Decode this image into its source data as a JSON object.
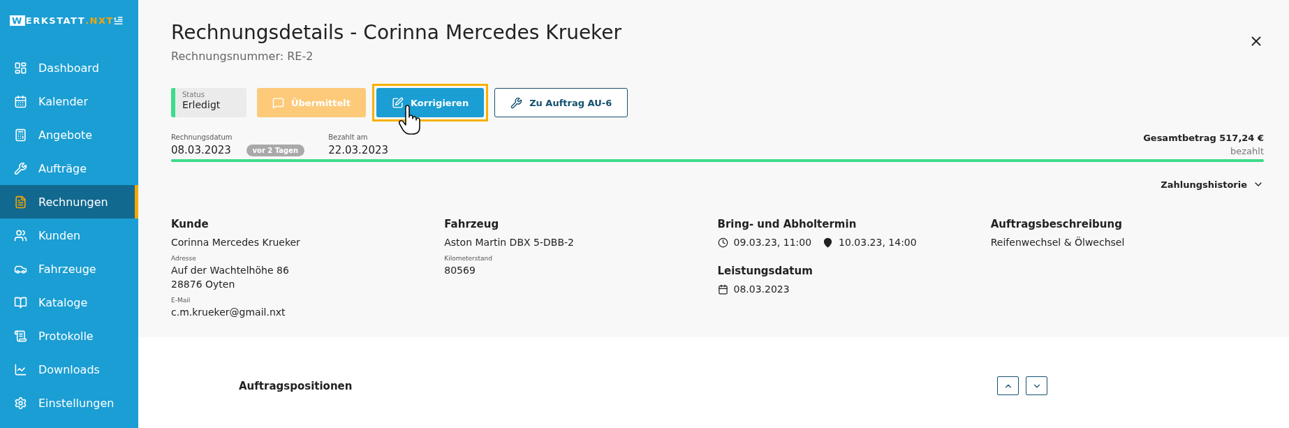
{
  "sidebar": {
    "logo": {
      "initial": "W",
      "name": "ERKSTATT",
      "suffix": ".NXT"
    },
    "items": [
      {
        "label": "Dashboard",
        "selected": false
      },
      {
        "label": "Kalender",
        "selected": false
      },
      {
        "label": "Angebote",
        "selected": false
      },
      {
        "label": "Aufträge",
        "selected": false
      },
      {
        "label": "Rechnungen",
        "selected": true
      },
      {
        "label": "Kunden",
        "selected": false
      },
      {
        "label": "Fahrzeuge",
        "selected": false
      },
      {
        "label": "Kataloge",
        "selected": false
      },
      {
        "label": "Protokolle",
        "selected": false
      },
      {
        "label": "Downloads",
        "selected": false
      },
      {
        "label": "Einstellungen",
        "selected": false
      }
    ]
  },
  "header": {
    "title": "Rechnungsdetails - Corinna Mercedes Krueker",
    "subtitle": "Rechnungsnummer: RE-2"
  },
  "status": {
    "label": "Status",
    "value": "Erledigt"
  },
  "actions": [
    {
      "kind": "sent",
      "label": "Übermittelt",
      "disabled": true,
      "focused": false
    },
    {
      "kind": "edit",
      "label": "Korrigieren",
      "disabled": false,
      "focused": true
    },
    {
      "kind": "order",
      "label": "Zu Auftrag AU-6",
      "disabled": false,
      "focused": false
    }
  ],
  "dates": [
    {
      "label": "Rechnungsdatum",
      "value": "08.03.2023",
      "badge": "vor 2 Tagen"
    },
    {
      "label": "Bezahlt am",
      "value": "22.03.2023"
    }
  ],
  "total": {
    "amount": "Gesamtbetrag 517,24 €",
    "status": "bezahlt",
    "level": 1
  },
  "payment_history": {
    "label": "Zahlungshistorie",
    "expanded": false
  },
  "details": [
    {
      "kind": "info",
      "heading": "Kunde",
      "value": "Corinna Mercedes Krueker",
      "fields": [
        {
          "label": "Adresse",
          "lines": [
            "Auf der Wachtelhöhe 86",
            "28876 Oyten"
          ]
        },
        {
          "label": "E-Mail",
          "lines": [
            "c.m.krueker@gmail.nxt"
          ]
        }
      ]
    },
    {
      "kind": "info",
      "heading": "Fahrzeug",
      "value": "Aston Martin DBX 5-DBB-2",
      "fields": [
        {
          "label": "Kilometerstand",
          "lines": [
            "80569"
          ]
        }
      ]
    },
    {
      "kind": "schedule",
      "heading": "Bring- und Abholtermin",
      "pickup": "09.03.23, 11:00",
      "return": "10.03.23, 14:00",
      "service_heading": "Leistungsdatum",
      "service_date": "08.03.2023"
    },
    {
      "kind": "info",
      "heading": "Auftragsbeschreibung",
      "value": "Reifenwechsel & Ölwechsel"
    }
  ],
  "positions": {
    "title": "Auftragspositionen"
  }
}
